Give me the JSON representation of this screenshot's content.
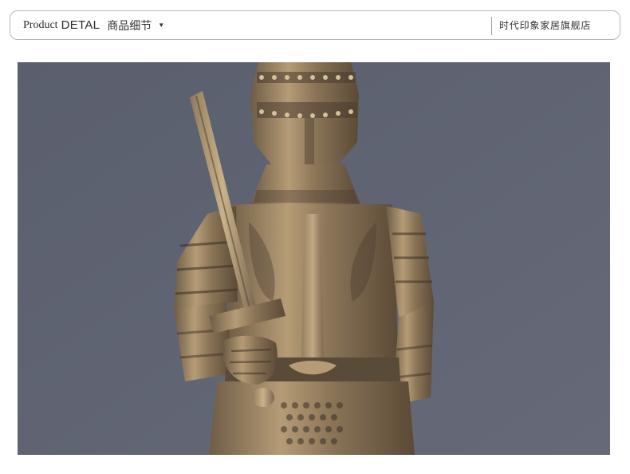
{
  "header": {
    "product_label": "Product",
    "detail_label": "DETAL",
    "cn_label": "商品细节",
    "dropdown_arrow": "▼",
    "store_name": "时代印象家居旗舰店"
  },
  "photo": {
    "subject": "knight-statue",
    "background_color": "#5f6473",
    "bronze_color": "#a08a6a"
  }
}
